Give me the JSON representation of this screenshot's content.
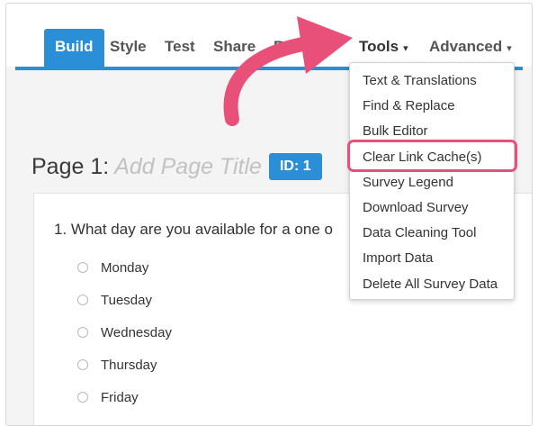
{
  "nav": {
    "tabs": [
      {
        "label": "Build",
        "active": true
      },
      {
        "label": "Style"
      },
      {
        "label": "Test"
      },
      {
        "label": "Share"
      },
      {
        "label": "Re"
      },
      {
        "label": "Tools"
      },
      {
        "label": "Advanced"
      }
    ],
    "caret": "▾",
    "accent_color": "#2b8fd8"
  },
  "tools_menu": {
    "items": [
      "Text & Translations",
      "Find & Replace",
      "Bulk Editor",
      "Clear Link Cache(s)",
      "Survey Legend",
      "Download Survey",
      "Data Cleaning Tool",
      "Import Data",
      "Delete All Survey Data"
    ],
    "highlight_color": "#e8507a"
  },
  "page": {
    "title_prefix": "Page 1:",
    "title_placeholder": "Add Page Title",
    "id_badge": "ID: 1"
  },
  "question": {
    "text": "1. What day are you available for a one o",
    "choices": [
      "Monday",
      "Tuesday",
      "Wednesday",
      "Thursday",
      "Friday"
    ]
  },
  "annotation": {
    "arrow_color": "#e8507a",
    "arrow_icon": "curved-arrow-icon"
  }
}
